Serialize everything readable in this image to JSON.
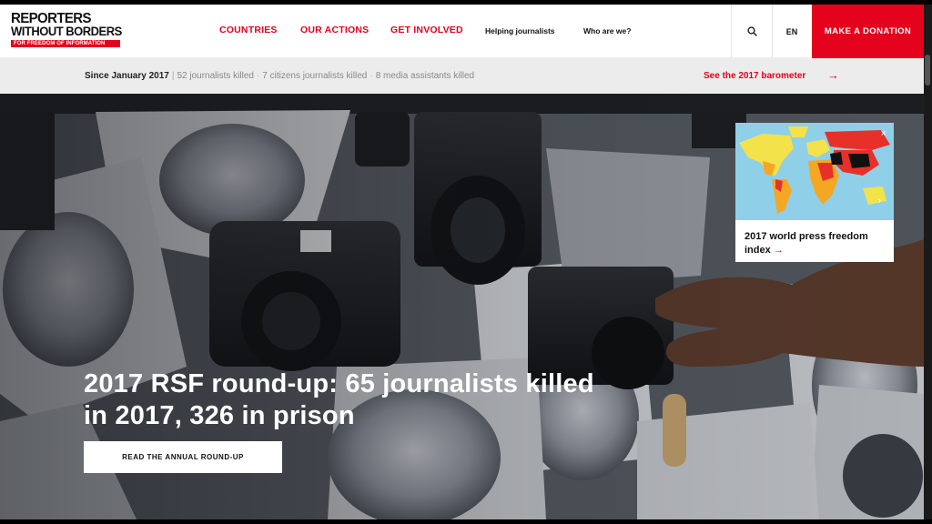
{
  "header": {
    "logo": {
      "line1": "REPORTERS",
      "line2": "WITHOUT BORDERS",
      "tagline": "FOR FREEDOM OF INFORMATION"
    },
    "nav": [
      {
        "label": "COUNTRIES"
      },
      {
        "label": "OUR ACTIONS"
      },
      {
        "label": "GET INVOLVED"
      },
      {
        "label": "Helping journalists"
      },
      {
        "label": "Who are we?"
      }
    ],
    "search_icon": "search-icon",
    "language": "EN",
    "donate_label": "MAKE A DONATION"
  },
  "stats": {
    "since": "Since January 2017",
    "journalists": "52 journalists killed",
    "citizens": "7 citizens journalists killed",
    "assistants": "8 media assistants killed",
    "barometer_link": "See the 2017 barometer",
    "barometer_arrow": "→"
  },
  "hero": {
    "title": "2017 RSF round-up: 65 journalists killed in 2017, 326 in prison",
    "cta": "READ THE ANNUAL ROUND-UP"
  },
  "index_card": {
    "title": "2017 world press freedom index",
    "arrow": "→",
    "close": "×",
    "chevron": "›"
  },
  "colors": {
    "brand_red": "#e4021c",
    "stats_bg": "#ececec"
  }
}
